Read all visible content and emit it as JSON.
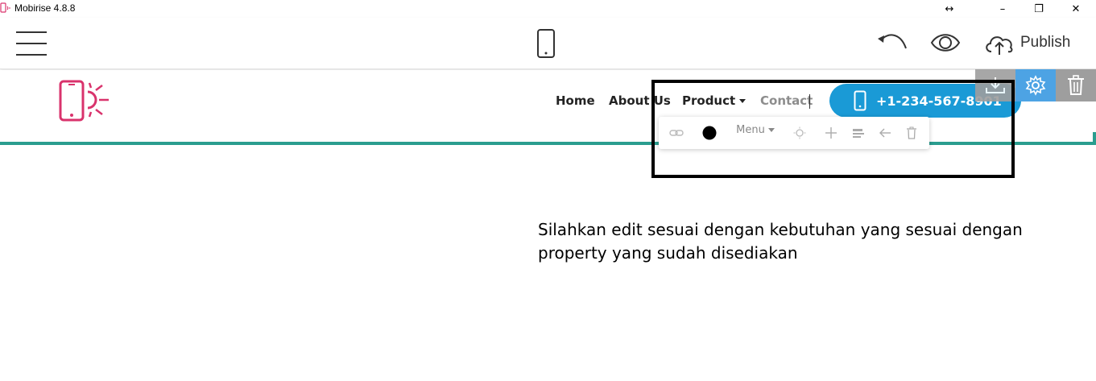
{
  "window": {
    "title": "Mobirise 4.8.8",
    "controls": {
      "resize": "↔",
      "minimize": "–",
      "maximize": "❐",
      "close": "✕"
    }
  },
  "toolbar": {
    "publish_label": "Publish",
    "icons": [
      "menu-icon",
      "mobile-preview-icon",
      "undo-icon",
      "preview-eye-icon",
      "cloud-upload-icon"
    ]
  },
  "block_actions": {
    "icons": [
      "download-icon",
      "gear-icon",
      "trash-icon"
    ],
    "colors": {
      "download_bg": "#9e9e9e",
      "gear_bg": "#4da3e4",
      "trash_bg": "#9e9e9e"
    }
  },
  "site": {
    "nav": {
      "items": [
        {
          "label": "Home"
        },
        {
          "label": "About Us"
        },
        {
          "label": "Product"
        },
        {
          "label": "Contact"
        }
      ],
      "phone_button": "+1-234-567-8901"
    },
    "logo_icon": "phone-sun-logo-icon",
    "colors": {
      "logo": "#d9336c",
      "accent_line": "#2a9d8f",
      "phone_button": "#1a9ad6"
    }
  },
  "popup": {
    "menu_label": "Menu",
    "icons": [
      "link-icon",
      "color-dot-icon",
      "sun-icon",
      "plus-icon",
      "align-icon",
      "arrow-left-icon",
      "trash-icon"
    ]
  },
  "content": {
    "text": "Silahkan edit sesuai dengan kebutuhan yang sesuai dengan property yang sudah disediakan"
  }
}
